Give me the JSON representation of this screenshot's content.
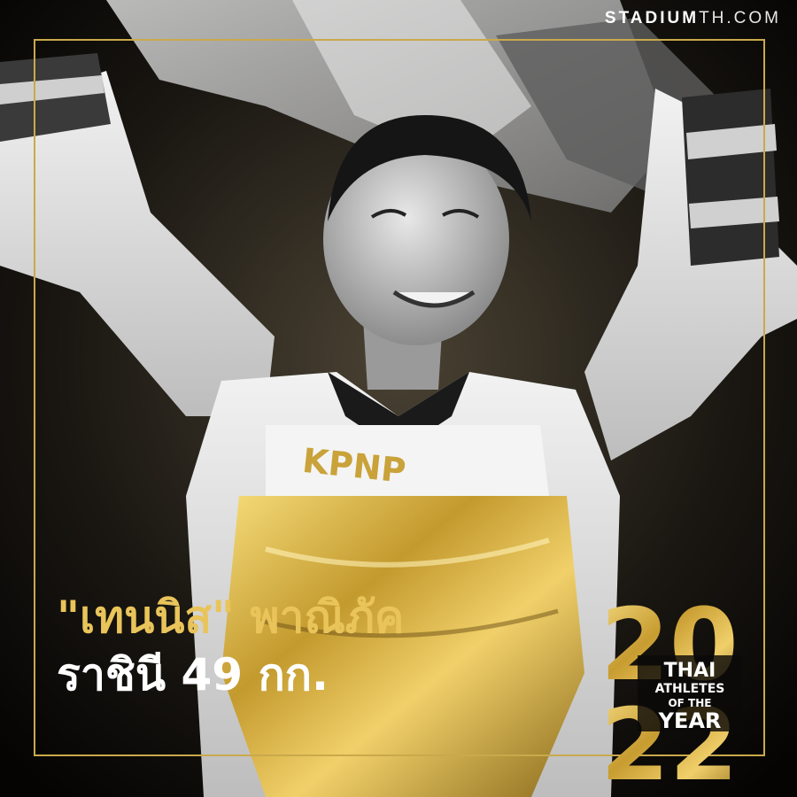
{
  "site": {
    "brand_bold": "STADIUM",
    "brand_thin": "TH.COM"
  },
  "caption": {
    "name_quoted": "\"เทนนิส\"",
    "name_full": "พาณิภัค",
    "subtitle": "ราชินี 49 กก."
  },
  "vest_text": "KPNP",
  "badge": {
    "year_top": "20",
    "year_bottom": "22",
    "line1": "THAI",
    "line2": "ATHLETES",
    "line3": "OF THE",
    "line4": "YEAR"
  },
  "colors": {
    "gold": "#d9b24a",
    "frame": "#c9a94b",
    "background": "#0b0a08"
  }
}
